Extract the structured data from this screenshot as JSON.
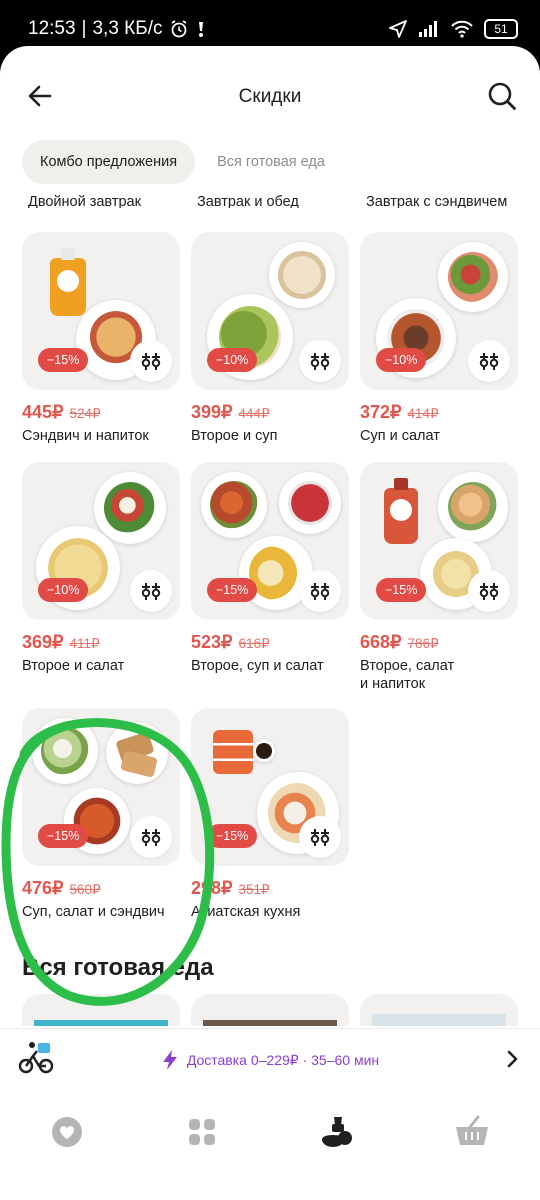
{
  "status_bar": {
    "time": "12:53",
    "network_speed": "3,3 КБ/с",
    "battery": "51",
    "icons": [
      "alarm-icon",
      "sim-icon",
      "location-arrow-icon",
      "signal-icon",
      "wifi-icon",
      "battery-icon"
    ]
  },
  "header": {
    "title": "Скидки",
    "back_icon": "arrow-left-icon",
    "search_icon": "search-icon"
  },
  "tabs": [
    {
      "label": "Комбо предложения",
      "active": true
    },
    {
      "label": "Вся готовая еда",
      "active": false
    }
  ],
  "cut_off_labels": [
    "Двойной завтрак",
    "Завтрак и обед",
    "Завтрак с сэндвичем"
  ],
  "products": [
    {
      "name": "Сэндвич и напиток",
      "price": "445₽",
      "old_price": "524₽",
      "discount": "−15%"
    },
    {
      "name": "Второе и суп",
      "price": "399₽",
      "old_price": "444₽",
      "discount": "−10%"
    },
    {
      "name": "Суп и салат",
      "price": "372₽",
      "old_price": "414₽",
      "discount": "−10%"
    },
    {
      "name": "Второе и салат",
      "price": "369₽",
      "old_price": "411₽",
      "discount": "−10%"
    },
    {
      "name": "Второе, суп и салат",
      "price": "523₽",
      "old_price": "616₽",
      "discount": "−15%"
    },
    {
      "name": "Второе, салат\nи напиток",
      "price": "668₽",
      "old_price": "786₽",
      "discount": "−15%"
    },
    {
      "name": "Суп, салат и сэндвич",
      "price": "476₽",
      "old_price": "560₽",
      "discount": "−15%"
    },
    {
      "name": "Азиатская кухня",
      "price": "298₽",
      "old_price": "351₽",
      "discount": "−15%"
    }
  ],
  "section": {
    "title": "Вся готовая еда"
  },
  "delivery": {
    "text": "Доставка 0–229₽ · 35–60 мин",
    "bolt_icon": "lightning-icon",
    "courier_icon": "courier-bike-icon",
    "chevron_icon": "chevron-right-icon"
  },
  "bottom_nav": [
    {
      "icon": "heart-icon",
      "active": false
    },
    {
      "icon": "catalog-grid-icon",
      "active": false
    },
    {
      "icon": "ready-food-icon",
      "active": true
    },
    {
      "icon": "basket-icon",
      "active": false
    }
  ],
  "colors": {
    "price": "#e0574f",
    "discount_badge": "#e14a45",
    "delivery_text": "#8b3fd0",
    "annotation_circle": "#2dbe4a",
    "card_bg": "#f2f1ef",
    "tab_active_bg": "#f0efec"
  }
}
